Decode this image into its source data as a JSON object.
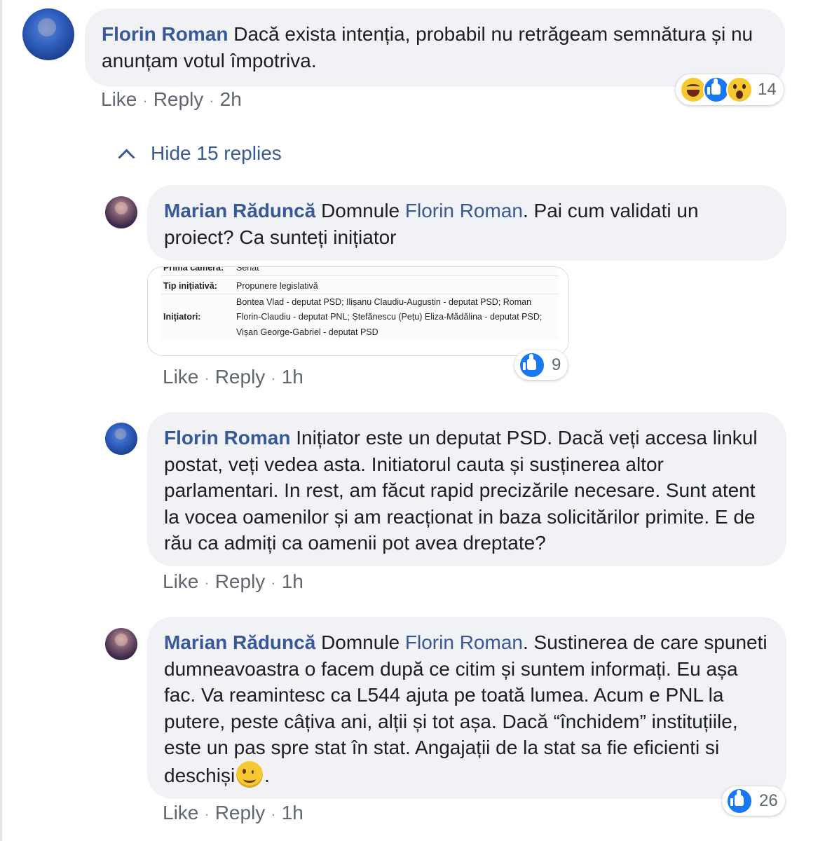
{
  "comment1": {
    "author": "Florin Roman",
    "text": "Dacă exista intenția, probabil nu retrăgeam semnătura și nu anunțam votul împotriva.",
    "actions": {
      "like": "Like",
      "reply": "Reply",
      "time": "2h"
    },
    "reactions": {
      "icons": [
        "haha-icon",
        "like-icon",
        "wow-icon"
      ],
      "count": "14"
    }
  },
  "hide_replies": "Hide 15 replies",
  "reply1": {
    "author": "Marian Răduncă",
    "prefix": "Domnule",
    "mention": "Florin Roman",
    "text": ". Pai cum validati un proiect? Ca sunteți inițiator",
    "attachment": {
      "row0_label": "Prima cameră:",
      "row0_value": "Senat",
      "row1_label": "Tip inițiativă:",
      "row1_value": "Propunere legislativă",
      "row2_label": "Inițiatori:",
      "row2_line1": "Bontea Vlad - deputat PSD; Ilișanu Claudiu-Augustin - deputat PSD; Roman",
      "row2_line2": "Florin-Claudiu - deputat PNL; Ștefănescu (Pețu) Eliza-Mădălina - deputat PSD;",
      "row2_line3": "Vișan George-Gabriel - deputat PSD"
    },
    "actions": {
      "like": "Like",
      "reply": "Reply",
      "time": "1h"
    },
    "reactions": {
      "icons": [
        "like-icon"
      ],
      "count": "9"
    }
  },
  "reply2": {
    "author": "Florin Roman",
    "text": "Inițiator este un deputat PSD. Dacă veți accesa linkul postat, veți vedea asta. Initiatorul cauta și susținerea altor parlamentari. In rest, am făcut rapid precizările necesare. Sunt atent la vocea oamenilor și am reacționat in baza solicitărilor primite. E de rău ca admiți ca oamenii pot avea dreptate?",
    "actions": {
      "like": "Like",
      "reply": "Reply",
      "time": "1h"
    }
  },
  "reply3": {
    "author": "Marian Răduncă",
    "prefix": "Domnule",
    "mention": "Florin Roman",
    "text": ". Sustinerea de care spuneti dumneavoastra o facem după ce citim și suntem informați. Eu așa fac. Va reamintesc ca L544 ajuta pe toată lumea. Acum e PNL la putere, peste câțiva ani, alții și tot așa. Dacă “închidem” instituțiile, este un pas spre stat în stat. Angajații de la stat sa fie eficienti si deschiși",
    "end": ".",
    "actions": {
      "like": "Like",
      "reply": "Reply",
      "time": "1h"
    },
    "reactions": {
      "icons": [
        "like-icon"
      ],
      "count": "26"
    }
  },
  "colors": {
    "link": "#385898",
    "bubble": "#f0f2f5",
    "meta": "#606770",
    "like_blue": "#1877f2",
    "emoji_yellow": "#f7c832"
  }
}
